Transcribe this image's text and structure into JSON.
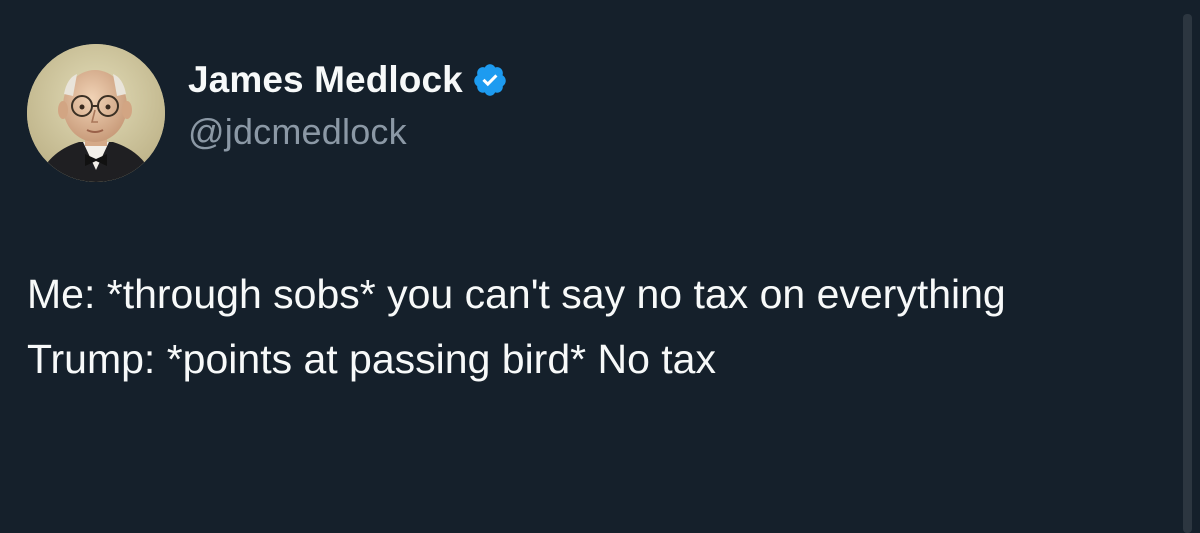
{
  "author": {
    "display_name": "James Medlock",
    "handle": "@jdcmedlock",
    "verified": true,
    "avatar": "portrait-photo"
  },
  "tweet": {
    "lines": [
      "Me: *through sobs* you can't say no tax on everything",
      "Trump: *points at passing bird* No tax"
    ]
  },
  "colors": {
    "background": "#15202b",
    "text": "#f7f9f9",
    "secondary_text": "#8b98a5",
    "verified_badge": "#1d9bf0"
  },
  "icons": {
    "verified": "verified-badge-icon"
  }
}
